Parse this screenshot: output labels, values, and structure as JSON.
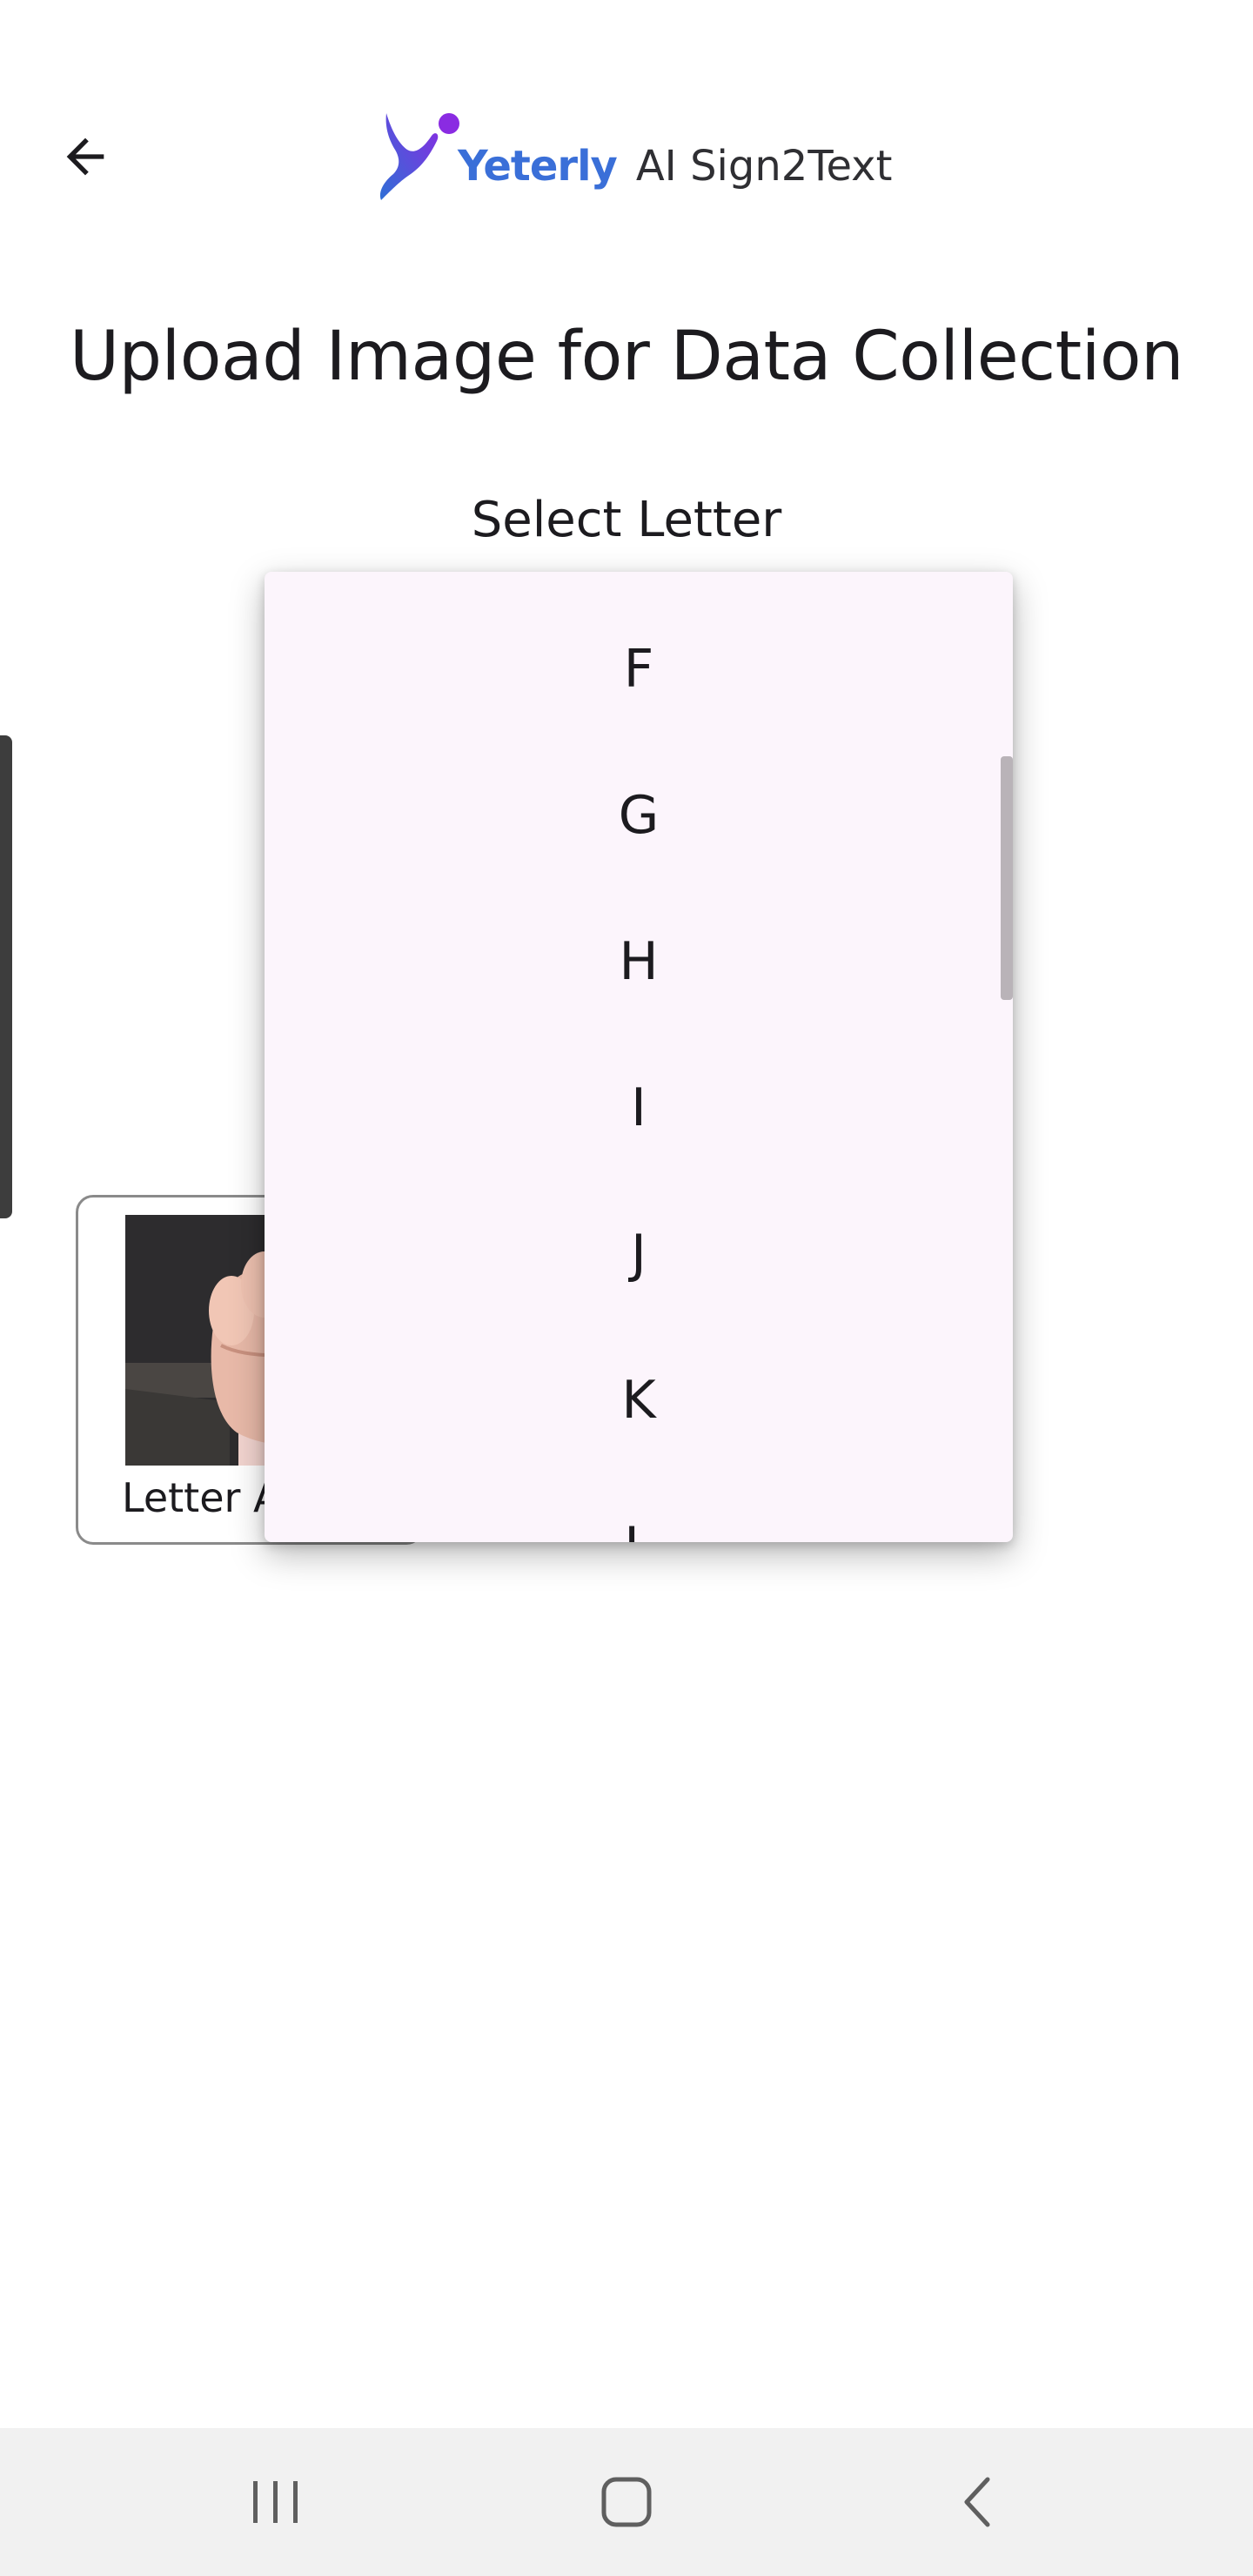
{
  "header": {
    "logo_name": "Yeterly",
    "logo_tagline": "AI Sign2Text",
    "back_icon": "arrow-left-icon"
  },
  "page": {
    "title": "Upload Image for Data Collection",
    "select_label": "Select Letter"
  },
  "card": {
    "caption": "Letter A"
  },
  "dropdown": {
    "options": [
      "F",
      "G",
      "H",
      "I",
      "J",
      "K",
      "L"
    ]
  },
  "nav": {
    "recents_icon": "recents-icon",
    "home_icon": "home-icon",
    "back_icon": "back-chevron-icon"
  },
  "colors": {
    "brand_blue": "#3a6fd8",
    "brand_purple": "#8a2be2",
    "dropdown_bg": "#fcf5fc"
  }
}
